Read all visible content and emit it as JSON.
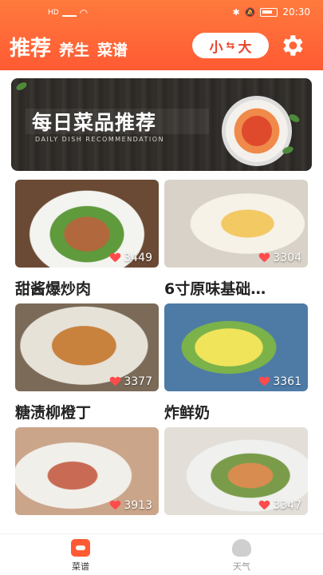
{
  "status_bar": {
    "network": "HD",
    "time": "20:30"
  },
  "header": {
    "tabs": [
      "推荐",
      "养生",
      "菜谱"
    ],
    "size_toggle": {
      "small": "小",
      "large": "大"
    }
  },
  "banner": {
    "title": "每日菜品推荐",
    "subtitle": "DAILY DISH RECOMMENDATION"
  },
  "dishes": [
    {
      "name": "甜酱爆炒肉",
      "likes": "3449"
    },
    {
      "name": "6寸原味基础…",
      "likes": "3304"
    },
    {
      "name": "糖渍柳橙丁",
      "likes": "3377"
    },
    {
      "name": "炸鲜奶",
      "likes": "3361"
    },
    {
      "name": "",
      "likes": "3913"
    },
    {
      "name": "",
      "likes": "3347"
    }
  ],
  "bottom_nav": [
    {
      "label": "菜谱",
      "active": true
    },
    {
      "label": "天气",
      "active": false
    }
  ],
  "colors": {
    "accent": "#ff5a33",
    "heart": "#ff4b4b"
  }
}
